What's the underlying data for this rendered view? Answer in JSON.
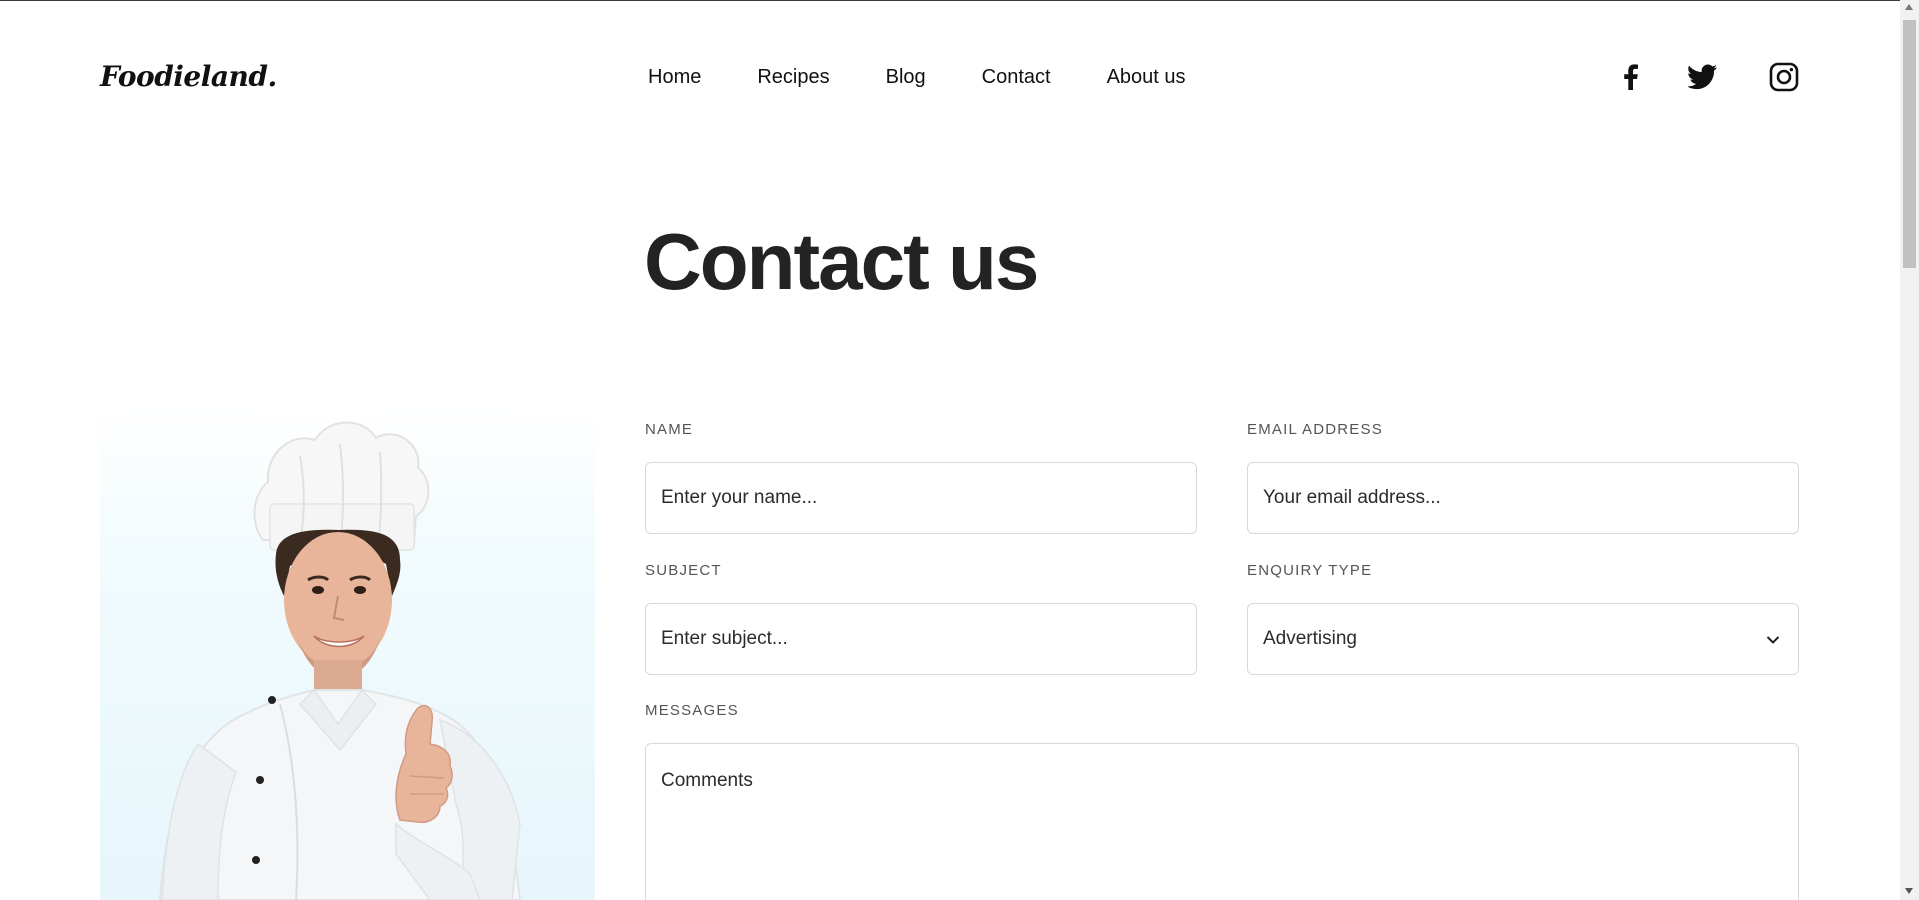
{
  "brand": {
    "logo_text": "Foodieland."
  },
  "nav": {
    "items": [
      {
        "label": "Home"
      },
      {
        "label": "Recipes"
      },
      {
        "label": "Blog"
      },
      {
        "label": "Contact"
      },
      {
        "label": "About us"
      }
    ]
  },
  "social": {
    "icons": [
      "facebook-icon",
      "twitter-icon",
      "instagram-icon"
    ]
  },
  "page": {
    "title": "Contact us"
  },
  "form": {
    "name": {
      "label": "NAME",
      "placeholder": "Enter your name..."
    },
    "email": {
      "label": "EMAIL ADDRESS",
      "placeholder": "Your email address..."
    },
    "subject": {
      "label": "SUBJECT",
      "placeholder": "Enter subject..."
    },
    "enquiry": {
      "label": "ENQUIRY TYPE",
      "value": "Advertising"
    },
    "messages": {
      "label": "MESSAGES",
      "placeholder": "Comments"
    }
  },
  "colors": {
    "text": "#232323",
    "border": "#d8d8d8",
    "label": "#555555",
    "chef_bg": "#e6f6fb"
  }
}
